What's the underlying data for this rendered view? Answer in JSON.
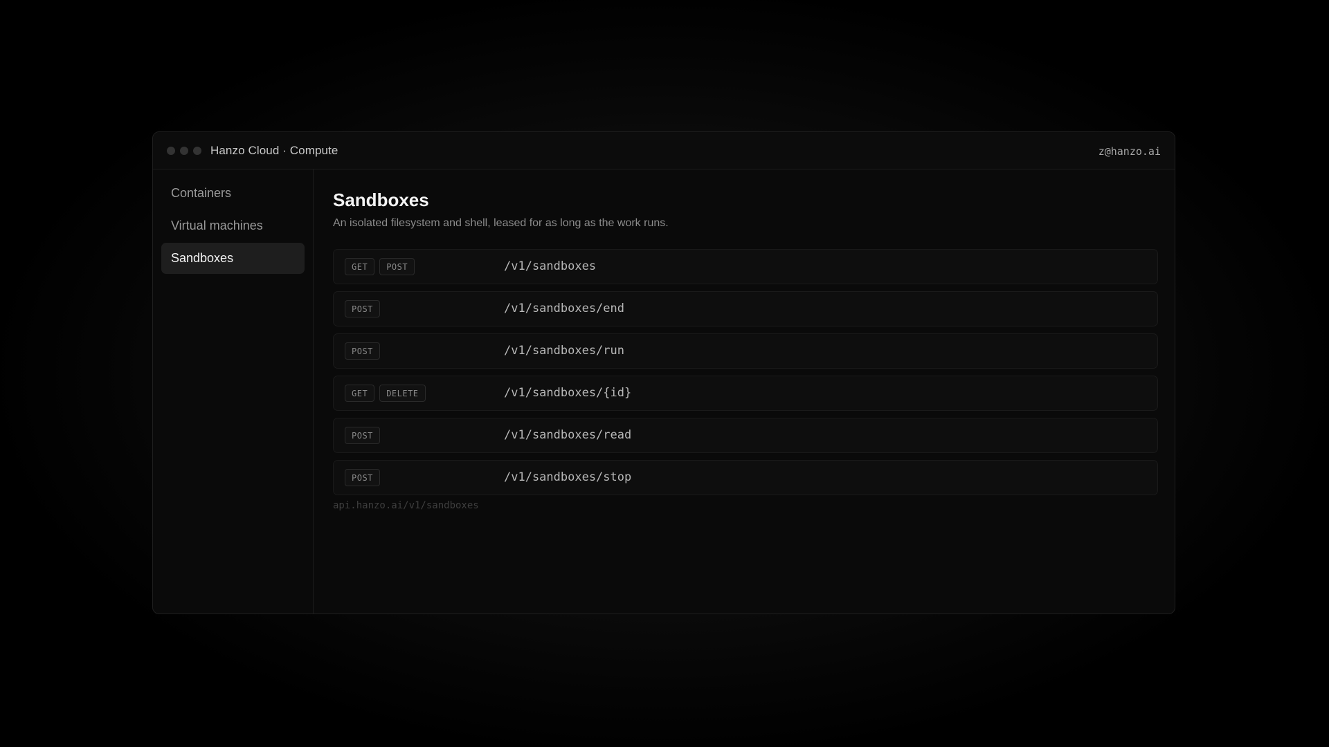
{
  "window": {
    "title": "Hanzo Cloud · Compute",
    "user": "z@hanzo.ai"
  },
  "sidebar": {
    "items": [
      {
        "label": "Containers",
        "active": false
      },
      {
        "label": "Virtual machines",
        "active": false
      },
      {
        "label": "Sandboxes",
        "active": true
      }
    ]
  },
  "main": {
    "title": "Sandboxes",
    "subtitle": "An isolated filesystem and shell, leased for as long as the work runs.",
    "endpoints": [
      {
        "methods": [
          "GET",
          "POST"
        ],
        "path": "/v1/sandboxes"
      },
      {
        "methods": [
          "POST"
        ],
        "path": "/v1/sandboxes/end"
      },
      {
        "methods": [
          "POST"
        ],
        "path": "/v1/sandboxes/run"
      },
      {
        "methods": [
          "GET",
          "DELETE"
        ],
        "path": "/v1/sandboxes/{id}"
      },
      {
        "methods": [
          "POST"
        ],
        "path": "/v1/sandboxes/read"
      },
      {
        "methods": [
          "POST"
        ],
        "path": "/v1/sandboxes/stop"
      }
    ],
    "base_url": "api.hanzo.ai/v1/sandboxes"
  },
  "colors": {
    "background": "#000000",
    "window": "#0a0a0a",
    "active_nav": "#1e1e1e",
    "text_primary": "#f4f4f4",
    "text_muted": "#8c8c8c"
  }
}
